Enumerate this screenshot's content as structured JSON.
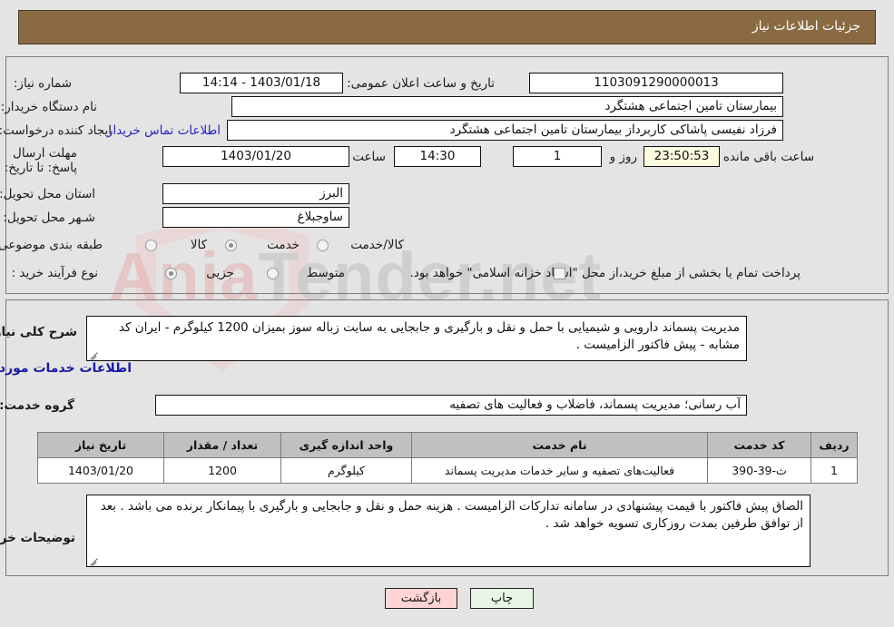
{
  "header": {
    "title": "جزئیات اطلاعات نیاز"
  },
  "form": {
    "need_number_label": "شماره نیاز:",
    "need_number_value": "1103091290000013",
    "announce_datetime_label": "تاریخ و ساعت اعلان عمومی:",
    "announce_datetime_value": "1403/01/18 - 14:14",
    "buyer_org_label": "نام دستگاه خریدار:",
    "buyer_org_value": "بیمارستان تامین اجتماعی هشتگرد",
    "creator_label": "ایجاد کننده درخواست:",
    "creator_value": "فرزاد  نفیسی پاشاکی کاربرداز بیمارستان تامین اجتماعی هشتگرد",
    "contact_link": "اطلاعات تماس خریدار",
    "deadline_label": "مهلت ارسال پاسخ: تا تاریخ:",
    "deadline_date": "1403/01/20",
    "deadline_hour_label": "ساعت",
    "deadline_hour_value": "14:30",
    "remaining_days": "1",
    "remaining_days_label": "روز و",
    "remaining_time": "23:50:53",
    "remaining_time_label": "ساعت باقی مانده",
    "province_label": "استان محل تحویل:",
    "province_value": "البرز",
    "city_label": "شـهر محل تحویل:",
    "city_value": "ساوجبلاغ",
    "category_label": "طبقه بندی موضوعی:",
    "category_options": [
      {
        "label": "کالا",
        "selected": false
      },
      {
        "label": "خدمت",
        "selected": true
      },
      {
        "label": "کالا/خدمت",
        "selected": false
      }
    ],
    "process_label": "نوع فرآیند خرید :",
    "process_options": [
      {
        "label": "جزیی",
        "selected": true
      },
      {
        "label": "متوسط",
        "selected": false
      }
    ],
    "treasury_checkbox_text": "پرداخت تمام یا بخشی از مبلغ خرید،از محل \"اسناد خزانه اسلامی\" خواهد بود."
  },
  "description": {
    "label": "شرح کلی نیاز:",
    "text": "مدیریت پسماند دارویی و شیمیایی با حمل و نقل و بارگیری و جابجایی  به سایت زباله سوز بمیزان 1200 کیلوگرم - ایران کد مشابه - پیش فاکتور الزامیست ."
  },
  "services_section": {
    "heading": "اطلاعات خدمات مورد نیاز",
    "group_label": "گروه خدمت:",
    "group_value": "آب رسانی؛ مدیریت پسماند، فاضلاب و فعالیت های تصفیه"
  },
  "table": {
    "columns": [
      "ردیف",
      "کد خدمت",
      "نام خدمت",
      "واحد اندازه گیری",
      "تعداد / مقدار",
      "تاریخ نیاز"
    ],
    "rows": [
      {
        "row": "1",
        "code": "ث-39-390",
        "name": "فعالیت‌های تصفیه و سایر خدمات مدیریت پسماند",
        "unit": "کیلوگرم",
        "quantity": "1200",
        "date": "1403/01/20"
      }
    ]
  },
  "buyer_notes": {
    "label": "توضیحات خریدار:",
    "text": "الصاق پیش فاکتور با قیمت پیشنهادی در سامانه تدارکات الزامیست . هزینه حمل و نقل و جابجایی و بارگیری با پیمانکار برنده می باشد . بعد از توافق طرفین بمدت روزکاری تسویه خواهد شد ."
  },
  "footer": {
    "print_label": "چاپ",
    "back_label": "بازگشت"
  },
  "watermark": {
    "text_left": "Ania",
    "text_right": "Tender.net"
  },
  "colors": {
    "header_bg": "#8a6a42",
    "link": "#2222cc",
    "heading_blue": "#1a1aa8",
    "table_header_bg": "#c0c0c0",
    "highlight_yellow": "#fbfbe0",
    "print_btn_bg": "#e8f5e4",
    "back_btn_bg": "#ffd4d4"
  }
}
